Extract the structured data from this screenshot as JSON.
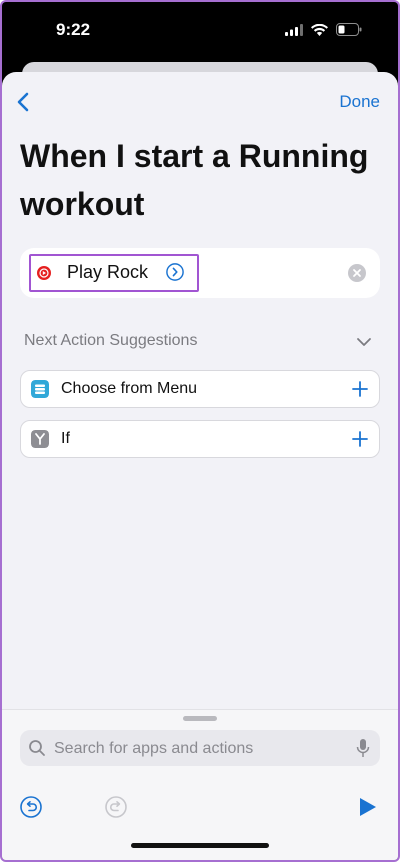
{
  "status": {
    "time": "9:22",
    "icons": [
      "signal-bars-icon",
      "wifi-icon",
      "battery-icon"
    ]
  },
  "nav": {
    "back_icon": "chevron-left-icon",
    "done_label": "Done"
  },
  "automation": {
    "title": "When I start a Running workout"
  },
  "action": {
    "app_icon": "youtube-music-icon",
    "label": "Play Rock",
    "detail_icon": "chevron-right-circle-icon",
    "clear_icon": "clear-x-icon"
  },
  "suggestions": {
    "header": "Next Action Suggestions",
    "items": [
      {
        "label": "Choose from Menu",
        "icon": "menu-icon"
      },
      {
        "label": "If",
        "icon": "if-branch-icon"
      }
    ]
  },
  "search": {
    "placeholder": "Search for apps and actions"
  },
  "toolbar": {
    "undo_icon": "undo-icon",
    "redo_icon": "redo-icon",
    "play_icon": "play-icon"
  },
  "colors": {
    "accent": "#1a73d1",
    "highlight": "#a155d2",
    "background": "#f2f2f7"
  }
}
